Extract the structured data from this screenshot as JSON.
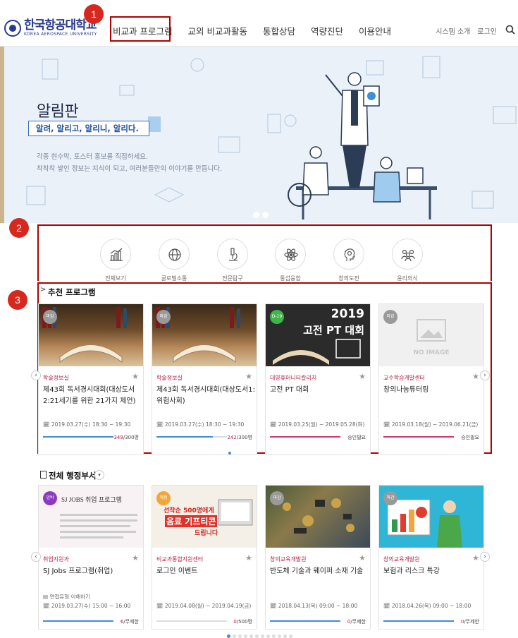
{
  "header": {
    "logo_ko": "한국항공대학교",
    "logo_en": "KOREA AEROSPACE UNIVERSITY",
    "nav": [
      "비교과 프로그램",
      "교외 비교과활동",
      "통합상담",
      "역량진단",
      "이용안내"
    ],
    "util": [
      "시스템 소개",
      "로그인"
    ]
  },
  "markers": [
    "1",
    "2",
    "3"
  ],
  "hero": {
    "title": "알림판",
    "tag": "알려, 알리고, 알리니, 알리다.",
    "desc1": "각종 현수막, 포스터 홍보를 직접하세요.",
    "desc2": "착착착 쌓인 정보는 지식이 되고, 여러분들만의 이야기를 만듭니다."
  },
  "categories": [
    "전체보기",
    "글로벌소통",
    "전문탐구",
    "통섭융합",
    "창의도전",
    "윤리의식"
  ],
  "recommended": {
    "title": "추천 프로그램",
    "cards": [
      {
        "badge": "마감",
        "badge_color": "#9a9a9a",
        "dept": "학술정보실",
        "title": "제43회 독서경시대회(대상도서2:21세기를 위한 21가지 제언)",
        "date": "2019.03.27(수) 18:30 ~ 19:30",
        "count": "349",
        "cap": "/300명",
        "progress": 1.0,
        "color": "#3d8fd6"
      },
      {
        "badge": "마감",
        "badge_color": "#9a9a9a",
        "dept": "학술정보실",
        "title": "제43회 독서경시대회(대상도서1:위험사회)",
        "date": "2019.03.27(수) 18:30 ~ 19:30",
        "count": "242",
        "cap": "/300명",
        "progress": 0.8,
        "color": "#3d8fd6"
      },
      {
        "badge": "D-19",
        "badge_color": "#3fb54a",
        "dept": "대양휴머니티칼리지",
        "title": "고전 PT 대회",
        "date": "2019.03.25(월) ~ 2019.05.28(화)",
        "count": "",
        "cap": "승인필요",
        "progress": 1.0,
        "color": "#d8336a",
        "img_text1": "2019",
        "img_text2": "고전 PT 대회"
      },
      {
        "badge": "마감",
        "badge_color": "#9a9a9a",
        "dept": "교수학습개발센터",
        "title": "창의나눔튜터링",
        "date": "2019.03.18(월) ~ 2019.06.21(금)",
        "count": "",
        "cap": "승인필요",
        "progress": 1.0,
        "color": "#d8336a",
        "noimg": "NO IMAGE"
      }
    ]
  },
  "departments": {
    "title": "전체 행정부서",
    "cards": [
      {
        "badge": "임박",
        "badge_color": "#8a3bbf",
        "dept": "취업지원과",
        "title": "SJ Jobs 프로그램(취업)",
        "extra": "면접유형 이해하기",
        "date": "2019.03.27(수) 15:00 ~ 16:00",
        "count": "6",
        "cap": "/무제한",
        "progress": 1.0,
        "color": "#3d8fd6",
        "img_text1": "SJ JOBS 취업 프로그램"
      },
      {
        "badge": "예정",
        "badge_color": "#f2a53a",
        "dept": "비교과통합지원센터",
        "title": "로그인 이벤트",
        "date": "2019.04.08(월) ~ 2019.04.19(금)",
        "count": "0",
        "cap": "/500명",
        "progress": 0.0,
        "color": "#3d8fd6",
        "img_text1": "선착순 500명에게",
        "img_text2": "음료 기프티콘",
        "img_text3": "드립니다"
      },
      {
        "badge": "마감",
        "badge_color": "#9a9a9a",
        "dept": "창의교육개발원",
        "title": "반도체 기술과 웨이퍼 소재 기술",
        "date": "2018.04.13(목) 09:00 ~ 18:00",
        "count": "0",
        "cap": "/무제한",
        "progress": 1.0,
        "color": "#3d8fd6"
      },
      {
        "badge": "마감",
        "badge_color": "#9a9a9a",
        "dept": "창의교육개발원",
        "title": "보험과 리스크 특강",
        "date": "2018.04.26(목) 09:00 ~ 18:00",
        "count": "0",
        "cap": "/무제한",
        "progress": 1.0,
        "color": "#3d8fd6"
      }
    ]
  }
}
